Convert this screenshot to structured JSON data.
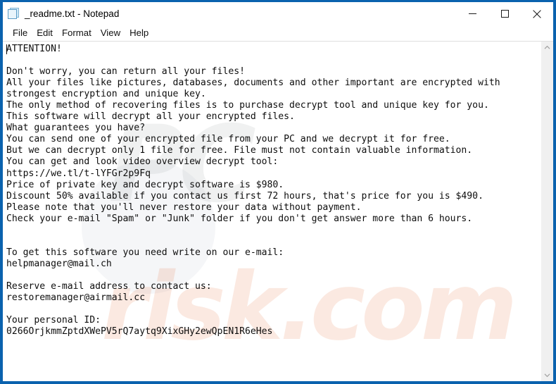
{
  "window": {
    "title": "_readme.txt - Notepad",
    "icon": "notepad-document-icon",
    "border_color": "#0a62ae",
    "controls": {
      "minimize": "─",
      "maximize": "□",
      "close": "✕"
    }
  },
  "menubar": {
    "items": [
      {
        "label": "File"
      },
      {
        "label": "Edit"
      },
      {
        "label": "Format"
      },
      {
        "label": "View"
      },
      {
        "label": "Help"
      }
    ]
  },
  "document": {
    "filename": "_readme.txt",
    "content": "ATTENTION!\n\nDon't worry, you can return all your files!\nAll your files like pictures, databases, documents and other important are encrypted with\nstrongest encryption and unique key.\nThe only method of recovering files is to purchase decrypt tool and unique key for you.\nThis software will decrypt all your encrypted files.\nWhat guarantees you have?\nYou can send one of your encrypted file from your PC and we decrypt it for free.\nBut we can decrypt only 1 file for free. File must not contain valuable information.\nYou can get and look video overview decrypt tool:\nhttps://we.tl/t-lYFGr2p9Fq\nPrice of private key and decrypt software is $980.\nDiscount 50% available if you contact us first 72 hours, that's price for you is $490.\nPlease note that you'll never restore your data without payment.\nCheck your e-mail \"Spam\" or \"Junk\" folder if you don't get answer more than 6 hours.\n\n\nTo get this software you need write on our e-mail:\nhelpmanager@mail.ch\n\nReserve e-mail address to contact us:\nrestoremanager@airmail.cc\n\nYour personal ID:\n0266OrjkmmZptdXWePV5rQ7aytq9XixGHy2ewQpEN1R6eHes",
    "key_values": {
      "video_url": "https://we.tl/t-lYFGr2p9Fq",
      "price": "$980",
      "discount_price": "$490",
      "discount_percent": "50%",
      "discount_window_hours": "72 hours",
      "answer_window_hours": "6 hours",
      "free_files": "1 file",
      "primary_email": "helpmanager@mail.ch",
      "reserve_email": "restoremanager@airmail.cc",
      "personal_id": "0266OrjkmmZptdXWePV5rQ7aytq9XixGHy2ewQpEN1R6eHes"
    }
  },
  "scrollbar": {
    "up_arrow": "∧",
    "down_arrow": "∨"
  },
  "watermark": {
    "text_top": "PC",
    "text_bottom": "risk.com"
  }
}
